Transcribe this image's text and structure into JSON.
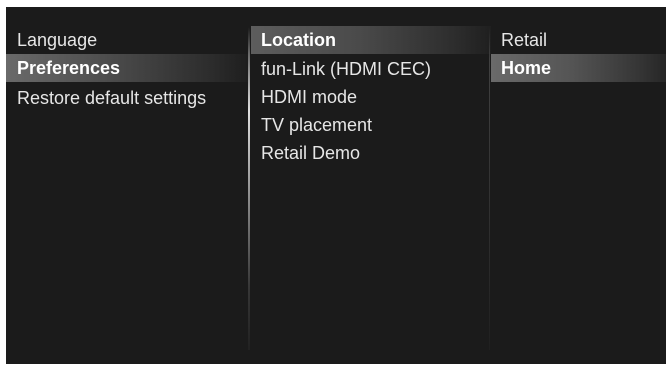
{
  "menu": {
    "column1": [
      {
        "label": "Language",
        "selected": false
      },
      {
        "label": "Preferences",
        "selected": true
      },
      {
        "label": "Restore default settings",
        "selected": false
      }
    ],
    "column2": [
      {
        "label": "Location",
        "selected": true
      },
      {
        "label": "fun-Link (HDMI CEC)",
        "selected": false
      },
      {
        "label": "HDMI mode",
        "selected": false
      },
      {
        "label": "TV placement",
        "selected": false
      },
      {
        "label": "Retail Demo",
        "selected": false
      }
    ],
    "column3": [
      {
        "label": "Retail",
        "selected": false
      },
      {
        "label": "Home",
        "selected": true
      }
    ]
  },
  "colors": {
    "background": "#1b1b1b",
    "text": "#e6e6e6",
    "selected_text": "#ffffff",
    "highlight": "#5a5a5a"
  }
}
